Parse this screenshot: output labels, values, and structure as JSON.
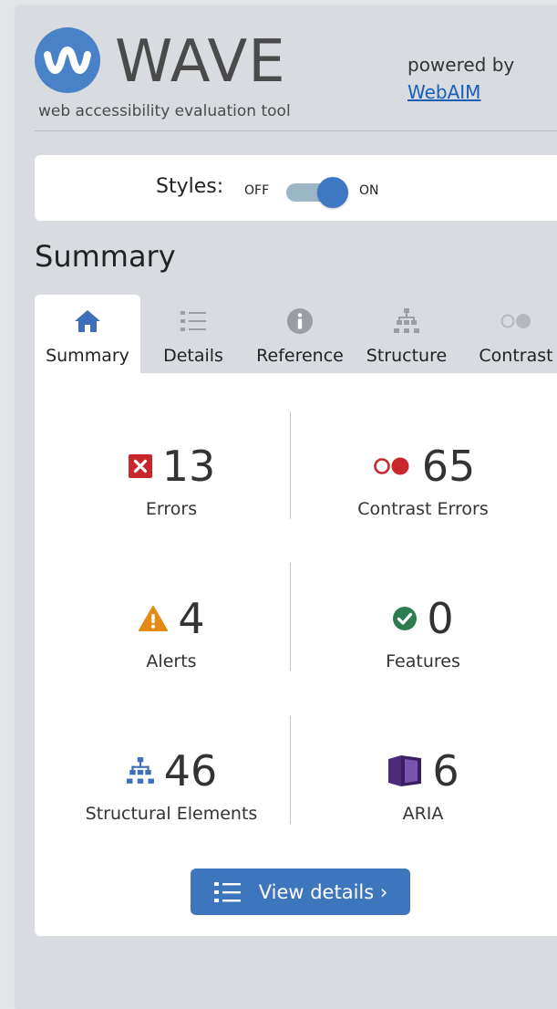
{
  "header": {
    "logo_word": "WAVE",
    "tagline": "web accessibility evaluation tool",
    "powered_by": "powered by",
    "powered_link": "WebAIM"
  },
  "styles_toggle": {
    "label": "Styles:",
    "off_label": "OFF",
    "on_label": "ON",
    "state": "on"
  },
  "summary_title": "Summary",
  "tabs": [
    {
      "label": "Summary",
      "icon": "home-icon",
      "active": true
    },
    {
      "label": "Details",
      "icon": "list-icon",
      "active": false
    },
    {
      "label": "Reference",
      "icon": "info-icon",
      "active": false
    },
    {
      "label": "Structure",
      "icon": "structure-icon",
      "active": false
    },
    {
      "label": "Contrast",
      "icon": "contrast-icon",
      "active": false
    }
  ],
  "stats": {
    "errors": {
      "value": "13",
      "label": "Errors",
      "icon": "error-icon",
      "color": "#c8282c"
    },
    "contrast_errors": {
      "value": "65",
      "label": "Contrast Errors",
      "icon": "contrast-error-icon",
      "color": "#c8282c"
    },
    "alerts": {
      "value": "4",
      "label": "Alerts",
      "icon": "alert-icon",
      "color": "#e28a14"
    },
    "features": {
      "value": "0",
      "label": "Features",
      "icon": "feature-check-icon",
      "color": "#2e7d4f"
    },
    "structural": {
      "value": "46",
      "label": "Structural Elements",
      "icon": "structure-icon",
      "color": "#3e6fb8"
    },
    "aria": {
      "value": "6",
      "label": "ARIA",
      "icon": "aria-icon",
      "color": "#4b2a7a"
    }
  },
  "view_details_label": "View details ›",
  "colors": {
    "brand_blue": "#4a82c7",
    "button_blue": "#3e76bd",
    "panel_bg": "#d8dbe0",
    "link": "#1a5fb4"
  }
}
